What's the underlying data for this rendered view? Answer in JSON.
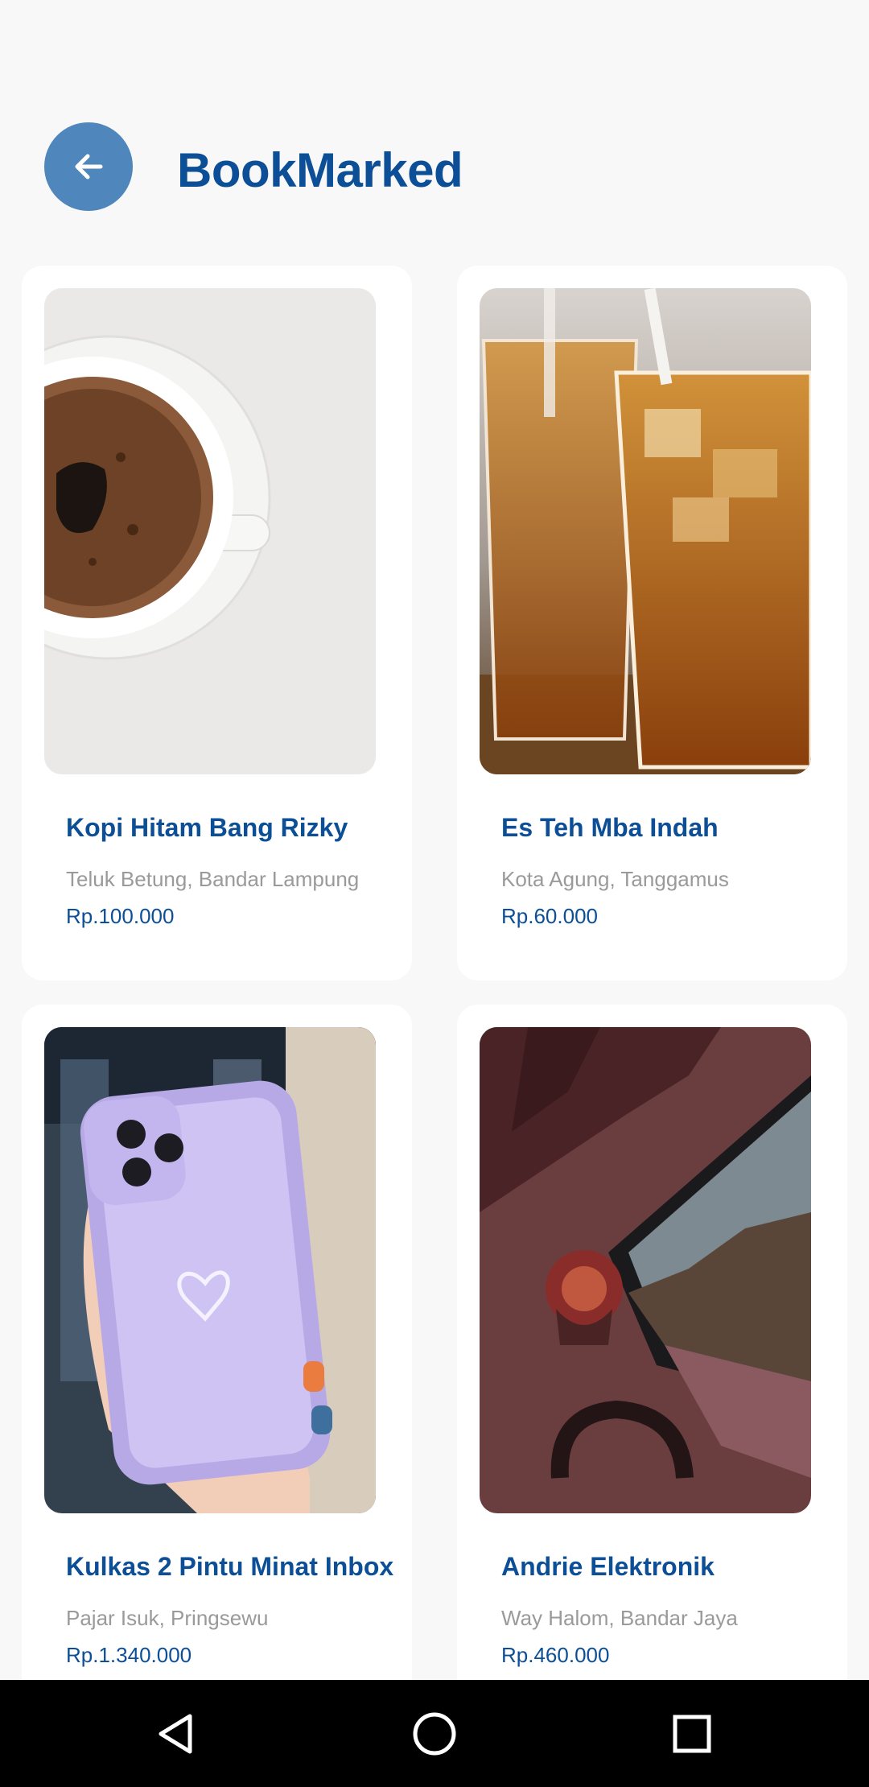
{
  "header": {
    "title": "BookMarked",
    "back_icon": "arrow-left-icon",
    "accent_color": "#4f86bb",
    "title_color": "#0d4f96"
  },
  "items": [
    {
      "name": "Kopi Hitam Bang Rizky",
      "location": "Teluk Betung, Bandar Lampung",
      "price": "Rp.100.000",
      "image": "black-coffee-cup"
    },
    {
      "name": "Es Teh Mba Indah",
      "location": "Kota Agung, Tanggamus",
      "price": "Rp.60.000",
      "image": "iced-tea-glasses"
    },
    {
      "name": "Kulkas 2 Pintu Minat Inbox",
      "location": "Pajar Isuk, Pringsewu",
      "price": "Rp.1.340.000",
      "image": "purple-phone-case"
    },
    {
      "name": "Andrie Elektronik",
      "location": "Way Halom, Bandar Jaya",
      "price": "Rp.460.000",
      "image": "laptop-headphones"
    }
  ],
  "navbar": {
    "buttons": [
      "back-triangle-icon",
      "home-circle-icon",
      "recents-square-icon"
    ]
  }
}
